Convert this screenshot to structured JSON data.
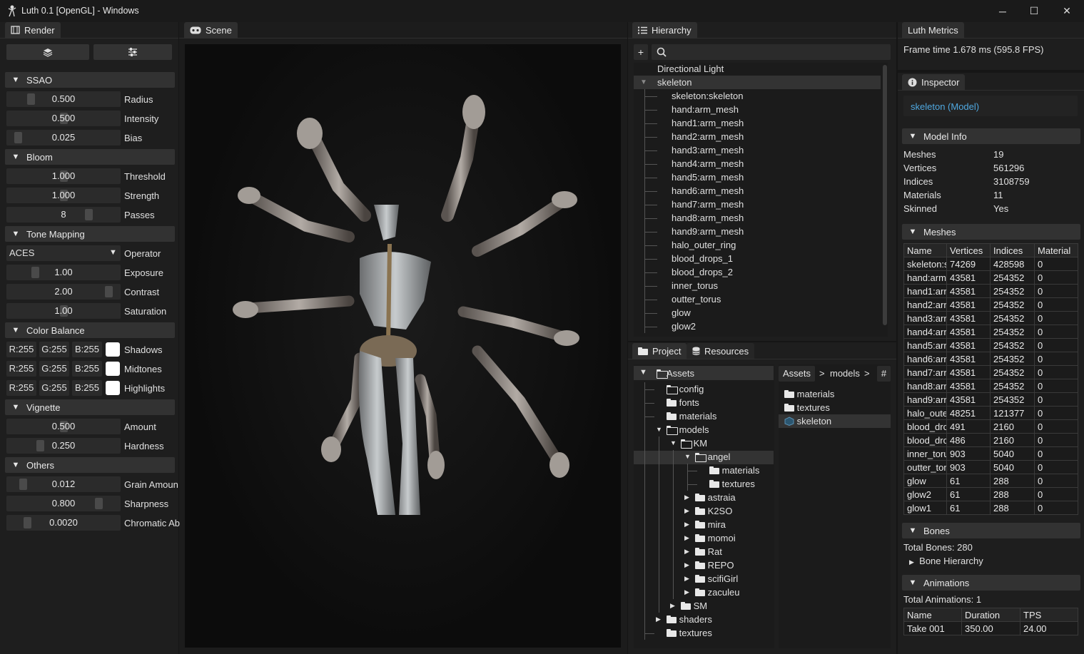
{
  "window": {
    "title": "Luth 0.1 [OpenGL] - Windows",
    "minimize": "─",
    "maximize": "☐",
    "close": "✕"
  },
  "render": {
    "tab": "Render",
    "sections": {
      "ssao": "SSAO",
      "bloom": "Bloom",
      "tonemap": "Tone Mapping",
      "colorbalance": "Color Balance",
      "vignette": "Vignette",
      "others": "Others"
    },
    "ssao": [
      {
        "v": "0.500",
        "l": "Radius"
      },
      {
        "v": "0.500",
        "l": "Intensity"
      },
      {
        "v": "0.025",
        "l": "Bias"
      }
    ],
    "bloom": [
      {
        "v": "1.000",
        "l": "Threshold"
      },
      {
        "v": "1.000",
        "l": "Strength"
      },
      {
        "v": "8",
        "l": "Passes"
      }
    ],
    "tonemap": {
      "operator": "ACES",
      "operator_label": "Operator",
      "rows": [
        {
          "v": "1.00",
          "l": "Exposure"
        },
        {
          "v": "2.00",
          "l": "Contrast"
        },
        {
          "v": "1.00",
          "l": "Saturation"
        }
      ]
    },
    "colorbalance": [
      {
        "r": "R:255",
        "g": "G:255",
        "b": "B:255",
        "l": "Shadows"
      },
      {
        "r": "R:255",
        "g": "G:255",
        "b": "B:255",
        "l": "Midtones"
      },
      {
        "r": "R:255",
        "g": "G:255",
        "b": "B:255",
        "l": "Highlights"
      }
    ],
    "vignette": [
      {
        "v": "0.500",
        "l": "Amount"
      },
      {
        "v": "0.250",
        "l": "Hardness"
      }
    ],
    "others": [
      {
        "v": "0.012",
        "l": "Grain Amoun"
      },
      {
        "v": "0.800",
        "l": "Sharpness"
      },
      {
        "v": "0.0020",
        "l": "Chromatic Ab"
      }
    ]
  },
  "scene": {
    "tab": "Scene"
  },
  "hierarchy": {
    "tab": "Hierarchy",
    "add": "+",
    "items": [
      "Directional Light",
      "skeleton",
      "skeleton:skeleton",
      "hand:arm_mesh",
      "hand1:arm_mesh",
      "hand2:arm_mesh",
      "hand3:arm_mesh",
      "hand4:arm_mesh",
      "hand5:arm_mesh",
      "hand6:arm_mesh",
      "hand7:arm_mesh",
      "hand8:arm_mesh",
      "hand9:arm_mesh",
      "halo_outer_ring",
      "blood_drops_1",
      "blood_drops_2",
      "inner_torus",
      "outter_torus",
      "glow",
      "glow2"
    ]
  },
  "project": {
    "tab": "Project",
    "resources_tab": "Resources",
    "root": "Assets",
    "tree": [
      "config",
      "fonts",
      "materials",
      "models",
      "KM",
      "angel",
      "materials",
      "textures",
      "astraia",
      "K2SO",
      "mira",
      "momoi",
      "Rat",
      "REPO",
      "scifiGirl",
      "zaculeu",
      "SM",
      "shaders",
      "textures"
    ],
    "crumbs": [
      "Assets",
      ">",
      "models",
      ">"
    ],
    "hash": "#",
    "files": [
      "materials",
      "textures",
      "skeleton"
    ]
  },
  "metrics": {
    "tab": "Luth Metrics",
    "frametime": "Frame time 1.678 ms (595.8 FPS)"
  },
  "inspector": {
    "tab": "Inspector",
    "selected": "skeleton (Model)",
    "model_info": "Model Info",
    "info": [
      {
        "k": "Meshes",
        "v": "19"
      },
      {
        "k": "Vertices",
        "v": "561296"
      },
      {
        "k": "Indices",
        "v": "3108759"
      },
      {
        "k": "Materials",
        "v": "11"
      },
      {
        "k": "Skinned",
        "v": "Yes"
      }
    ],
    "meshes_title": "Meshes",
    "mesh_headers": [
      "Name",
      "Vertices",
      "Indices",
      "Material"
    ],
    "meshes": [
      [
        "skeleton:s",
        "74269",
        "428598",
        "0"
      ],
      [
        "hand:arm",
        "43581",
        "254352",
        "0"
      ],
      [
        "hand1:arr",
        "43581",
        "254352",
        "0"
      ],
      [
        "hand2:arr",
        "43581",
        "254352",
        "0"
      ],
      [
        "hand3:arr",
        "43581",
        "254352",
        "0"
      ],
      [
        "hand4:arr",
        "43581",
        "254352",
        "0"
      ],
      [
        "hand5:arr",
        "43581",
        "254352",
        "0"
      ],
      [
        "hand6:arr",
        "43581",
        "254352",
        "0"
      ],
      [
        "hand7:arr",
        "43581",
        "254352",
        "0"
      ],
      [
        "hand8:arr",
        "43581",
        "254352",
        "0"
      ],
      [
        "hand9:arr",
        "43581",
        "254352",
        "0"
      ],
      [
        "halo_oute",
        "48251",
        "121377",
        "0"
      ],
      [
        "blood_drc",
        "491",
        "2160",
        "0"
      ],
      [
        "blood_drc",
        "486",
        "2160",
        "0"
      ],
      [
        "inner_toru",
        "903",
        "5040",
        "0"
      ],
      [
        "outter_tor",
        "903",
        "5040",
        "0"
      ],
      [
        "glow",
        "61",
        "288",
        "0"
      ],
      [
        "glow2",
        "61",
        "288",
        "0"
      ],
      [
        "glow1",
        "61",
        "288",
        "0"
      ]
    ],
    "bones_title": "Bones",
    "total_bones": "Total Bones: 280",
    "bone_hierarchy": "Bone Hierarchy",
    "anim_title": "Animations",
    "total_anims": "Total Animations: 1",
    "anim_headers": [
      "Name",
      "Duration",
      "TPS"
    ],
    "anims": [
      [
        "Take 001",
        "350.00",
        "24.00"
      ]
    ]
  }
}
